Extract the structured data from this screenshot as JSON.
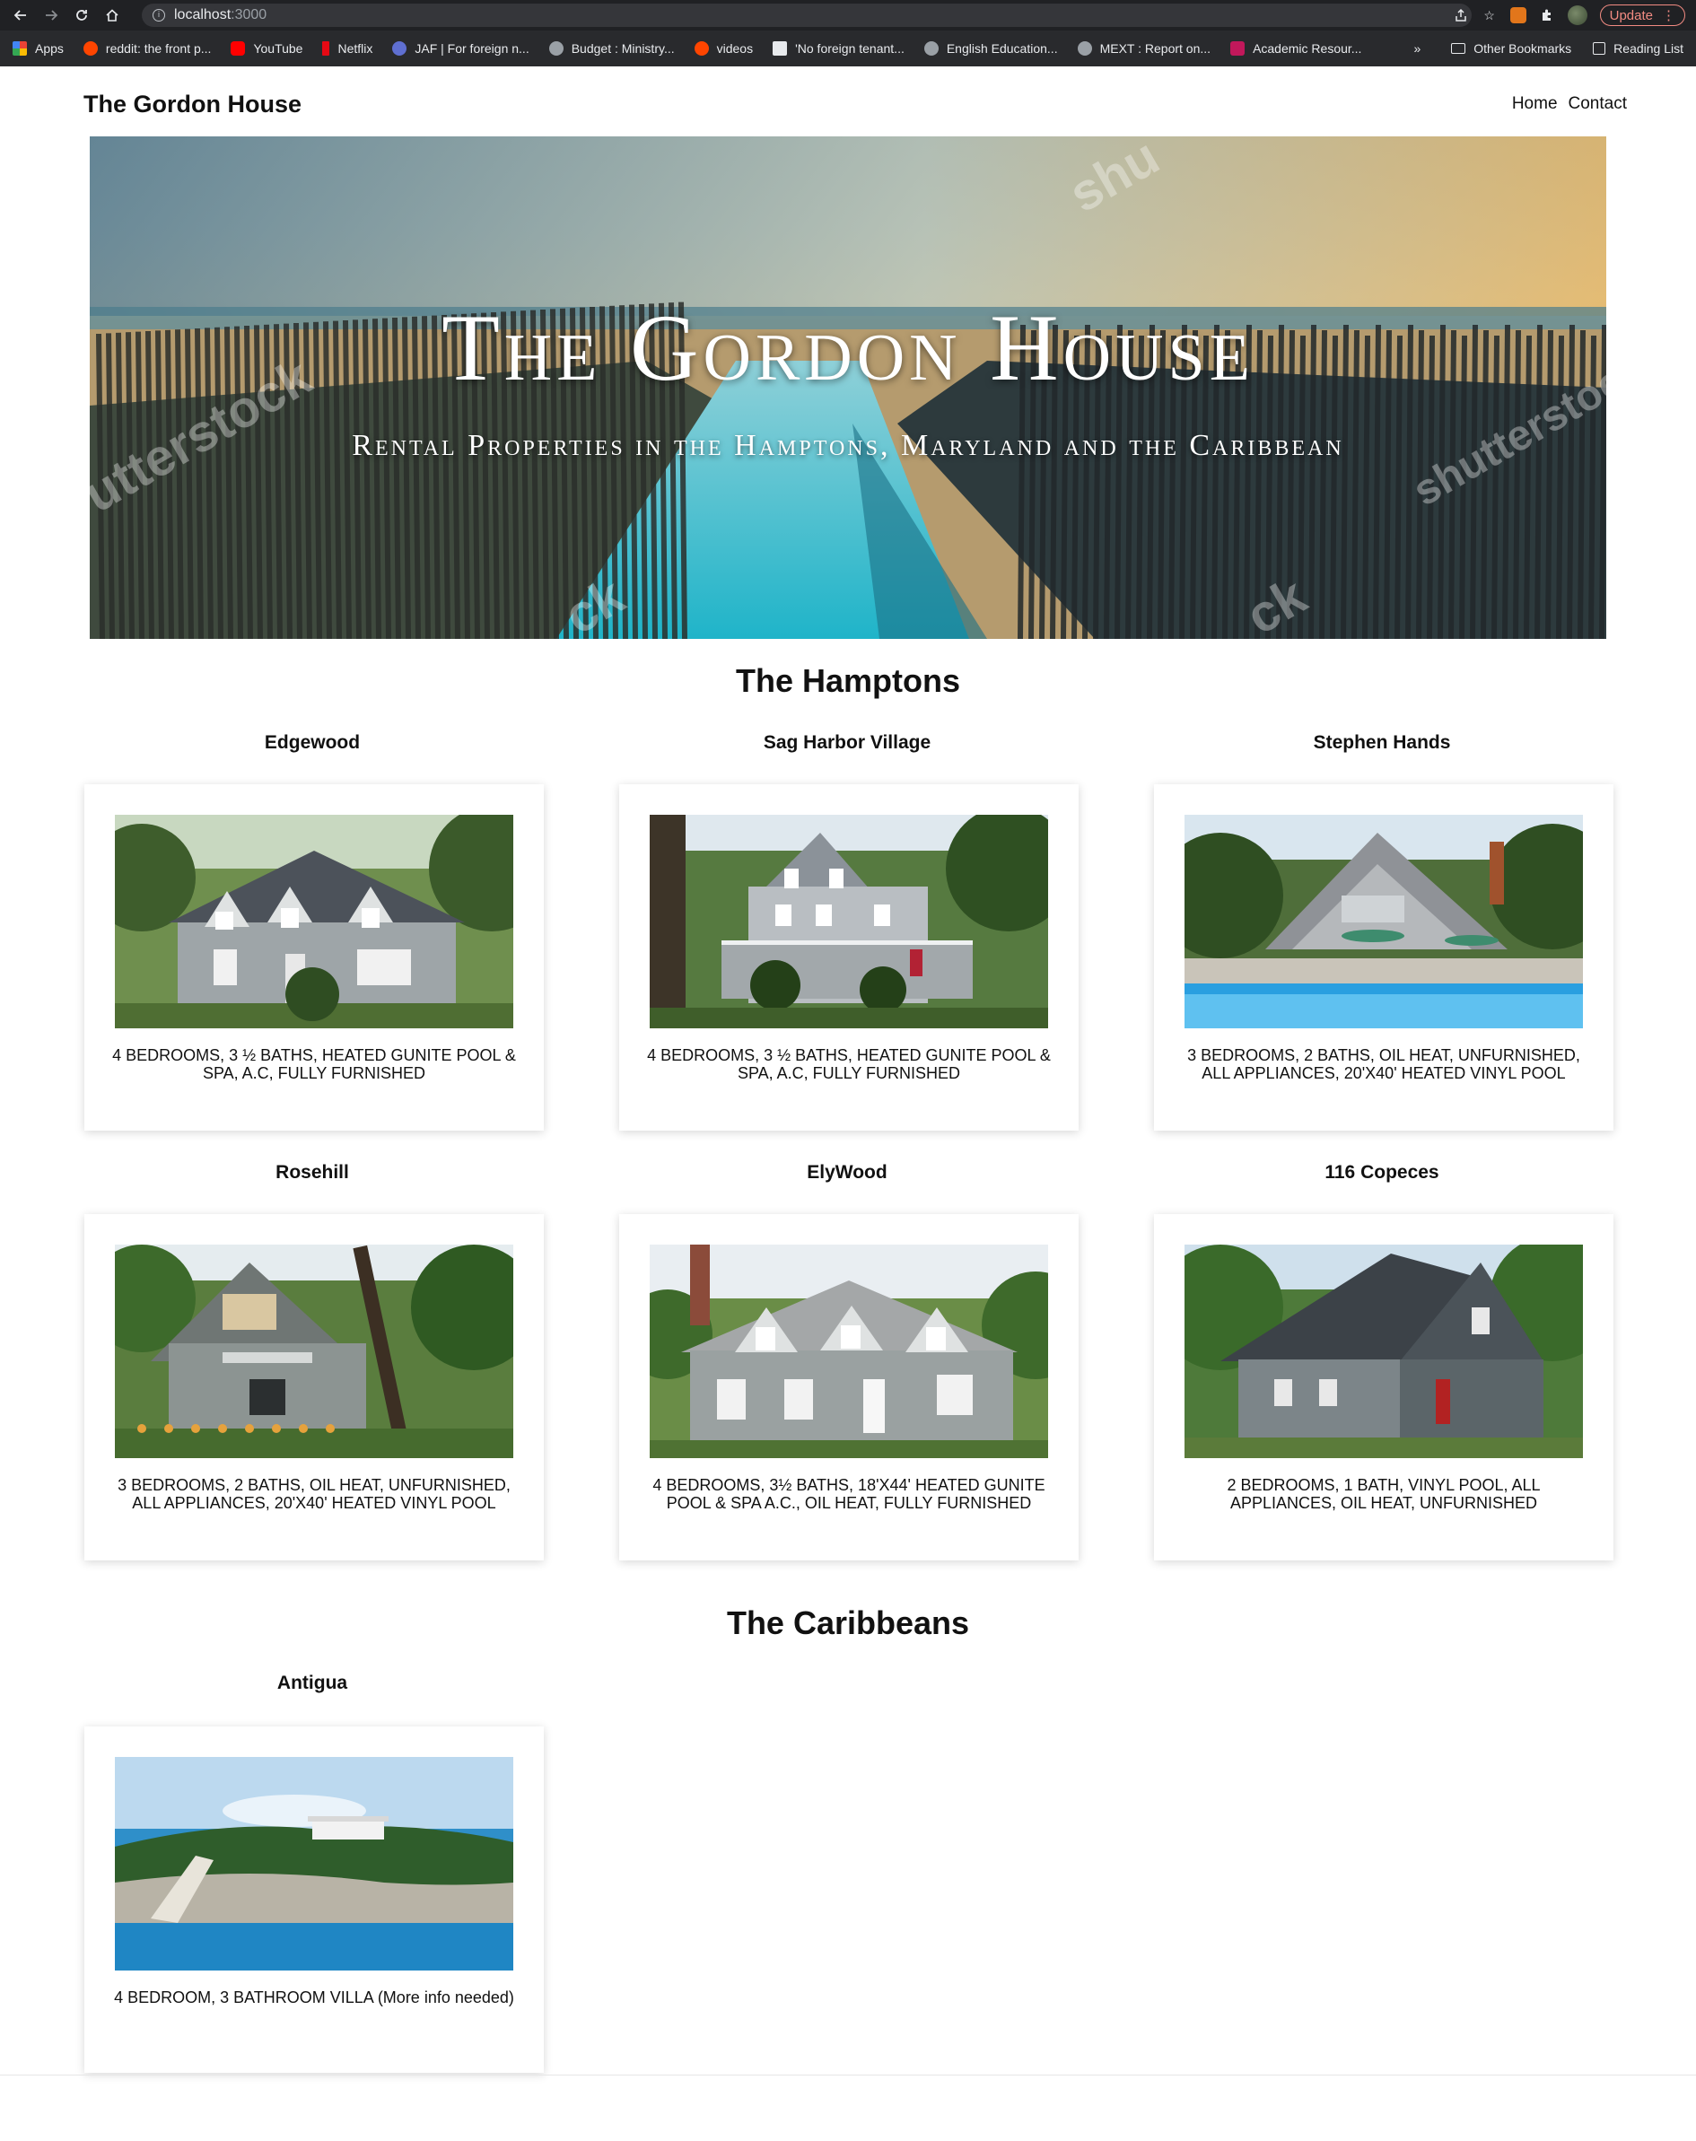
{
  "browser": {
    "url_host": "localhost",
    "url_port": ":3000",
    "update_label": "Update",
    "bookmarks": [
      {
        "label": "Apps",
        "color": "#ea4335"
      },
      {
        "label": "reddit: the front p...",
        "color": "#ff4500"
      },
      {
        "label": "YouTube",
        "color": "#ff0000"
      },
      {
        "label": "Netflix",
        "color": "#e50914"
      },
      {
        "label": "JAF | For foreign n...",
        "color": "#5f6fd1"
      },
      {
        "label": "Budget : Ministry...",
        "color": "#9aa0a6"
      },
      {
        "label": "videos",
        "color": "#ff4500"
      },
      {
        "label": "'No foreign tenant...",
        "color": "#e8eaed"
      },
      {
        "label": "English Education...",
        "color": "#9aa0a6"
      },
      {
        "label": "MEXT : Report on...",
        "color": "#9aa0a6"
      },
      {
        "label": "Academic Resour...",
        "color": "#c2185b"
      }
    ],
    "overflow": "»",
    "other_bookmarks": "Other Bookmarks",
    "reading_list": "Reading List"
  },
  "nav": {
    "brand": "The Gordon House",
    "links": [
      "Home",
      "Contact"
    ]
  },
  "hero": {
    "title": "The Gordon House",
    "subtitle": "Rental Properties in the Hamptons, Maryland and the Caribbean",
    "watermarks": [
      "shu",
      "utterstock",
      "shutterstock",
      "ck",
      "ck"
    ]
  },
  "sections": [
    {
      "title": "The Hamptons",
      "properties": [
        {
          "name": "Edgewood",
          "description": "4 Bedrooms, 3 ½ Baths, Heated Gunite Pool & Spa, A.C, Fully Furnished"
        },
        {
          "name": "Sag Harbor Village",
          "description": "4 Bedrooms, 3 ½ Baths, Heated Gunite Pool & Spa, A.C, Fully Furnished"
        },
        {
          "name": "Stephen Hands",
          "description": "3 Bedrooms, 2 Baths, Oil Heat, Unfurnished, All Appliances, 20'x40' Heated Vinyl Pool"
        },
        {
          "name": "Rosehill",
          "description": "3 Bedrooms, 2 Baths, Oil Heat, Unfurnished, All Appliances, 20'x40' Heated Vinyl Pool"
        },
        {
          "name": "ElyWood",
          "description": "4 Bedrooms, 3½ Baths, 18'x44' Heated Gunite Pool & Spa A.C., Oil Heat, Fully Furnished"
        },
        {
          "name": "116 Copeces",
          "description": "2 Bedrooms, 1 Bath, Vinyl Pool, All Appliances, Oil Heat, Unfurnished"
        }
      ]
    },
    {
      "title": "The Caribbeans",
      "properties": [
        {
          "name": "Antigua",
          "description": "4 BEDROOM, 3 BATHROOM VILLA (More info needed)"
        }
      ]
    }
  ],
  "colors": {
    "page_bg": "#ffffff",
    "chrome_dark": "#202124",
    "bookmark_bar": "#292a2d",
    "update_accent": "#f28b82"
  }
}
